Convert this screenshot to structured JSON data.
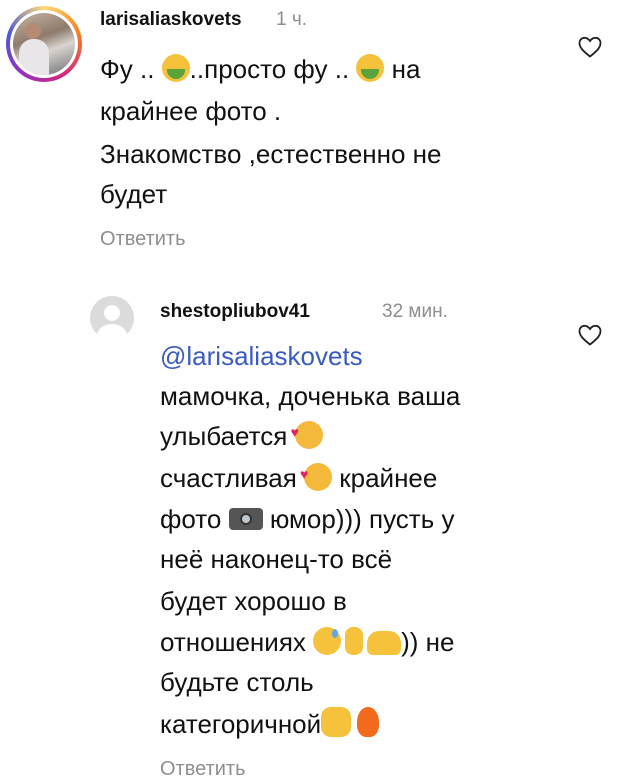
{
  "comments": [
    {
      "username": "larisaliaskovets",
      "time": "1 ч.",
      "lines": [
        {
          "parts": [
            "Фу .. ",
            "..просто фу .. ",
            " на"
          ]
        },
        {
          "text": "крайнее фото ."
        },
        {
          "text": "Знакомство ,естественно не"
        },
        {
          "text": "будет"
        }
      ],
      "reply_label": "Ответить",
      "icons": {
        "avatar": "story-avatar",
        "like": "heart-outline-icon",
        "emoji": "nauseated-face-icon"
      }
    },
    {
      "username": "shestopliubov41",
      "time": "32 мин.",
      "mention": "@larisaliaskovets",
      "lines": [
        {
          "text": "мамочка, доченька ваша"
        },
        {
          "text": "улыбается "
        },
        {
          "parts": [
            "счастливая ",
            " крайнее"
          ]
        },
        {
          "parts": [
            "фото ",
            " юмор))) пусть у"
          ]
        },
        {
          "text": "неё наконец-то всё"
        },
        {
          "text": "будет хорошо в"
        },
        {
          "parts": [
            "отношениях ",
            ")) не"
          ]
        },
        {
          "text": "будьте столь"
        },
        {
          "text": "категоричной"
        }
      ],
      "reply_label": "Ответить",
      "icons": {
        "avatar": "default-avatar",
        "like": "heart-outline-icon"
      }
    }
  ]
}
